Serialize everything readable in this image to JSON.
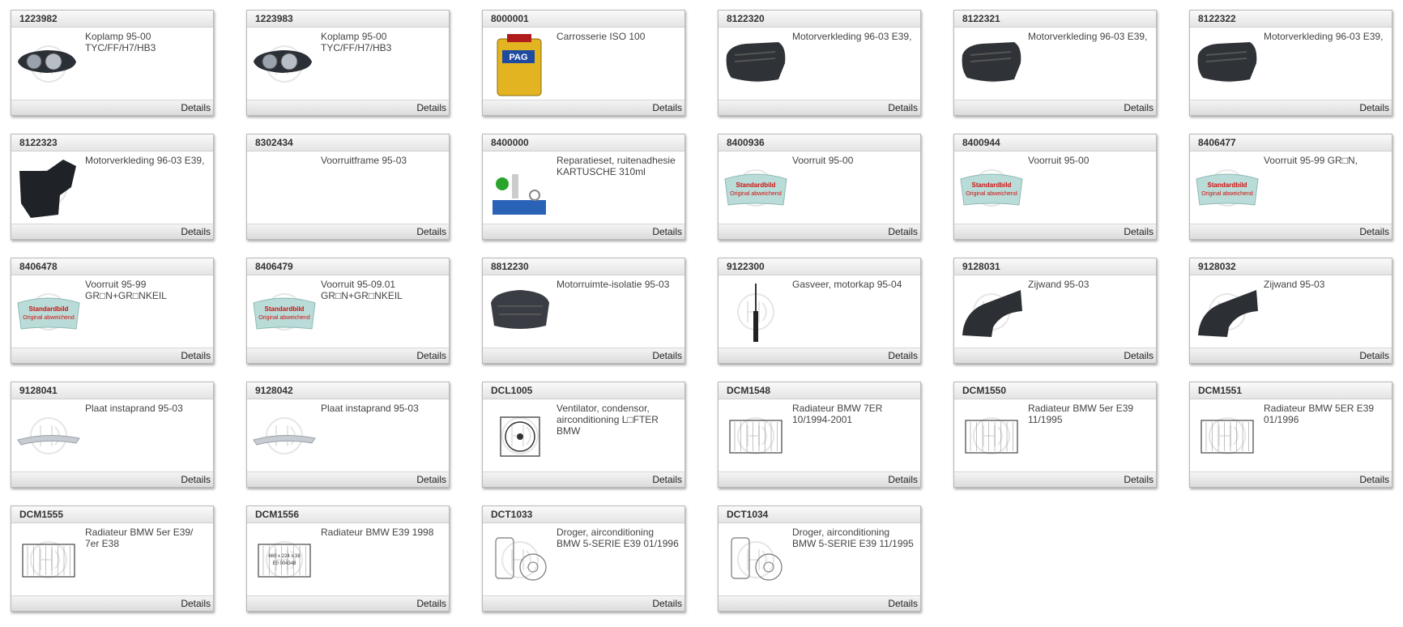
{
  "details_label": "Details",
  "products": [
    {
      "code": "1223982",
      "desc": "Koplamp 95-00 TYC/FF/H7/HB3",
      "image": "headlamp"
    },
    {
      "code": "1223983",
      "desc": "Koplamp 95-00 TYC/FF/H7/HB3",
      "image": "headlamp"
    },
    {
      "code": "8000001",
      "desc": "Carrosserie ISO 100",
      "image": "tin-can",
      "can_label": "PAG"
    },
    {
      "code": "8122320",
      "desc": "Motorverkleding 96-03 E39,",
      "image": "engine-cover"
    },
    {
      "code": "8122321",
      "desc": "Motorverkleding 96-03 E39,",
      "image": "engine-cover"
    },
    {
      "code": "8122322",
      "desc": "Motorverkleding 96-03 E39,",
      "image": "engine-cover"
    },
    {
      "code": "8122323",
      "desc": "Motorverkleding 96-03 E39,",
      "image": "splash-shield"
    },
    {
      "code": "8302434",
      "desc": "Voorruitframe 95-03",
      "image": "none"
    },
    {
      "code": "8400000",
      "desc": "Reparatieset, ruitenadhesie KARTUSCHE 310ml",
      "image": "repair-kit"
    },
    {
      "code": "8400936",
      "desc": "Voorruit 95-00",
      "image": "windshield",
      "badge_title": "Standardbild",
      "badge_sub": "Original abweichend"
    },
    {
      "code": "8400944",
      "desc": "Voorruit 95-00",
      "image": "windshield",
      "badge_title": "Standardbild",
      "badge_sub": "Original abweichend"
    },
    {
      "code": "8406477",
      "desc": "Voorruit 95-99 GR□N,",
      "image": "windshield",
      "badge_title": "Standardbild",
      "badge_sub": "Original abweichend"
    },
    {
      "code": "8406478",
      "desc": "Voorruit 95-99 GR□N+GR□NKEIL",
      "image": "windshield",
      "badge_title": "Standardbild",
      "badge_sub": "Original abweichend"
    },
    {
      "code": "8406479",
      "desc": "Voorruit 95-09.01 GR□N+GR□NKEIL",
      "image": "windshield",
      "badge_title": "Standardbild",
      "badge_sub": "Original abweichend"
    },
    {
      "code": "8812230",
      "desc": "Motorruimte-isolatie 95-03",
      "image": "insulation"
    },
    {
      "code": "9122300",
      "desc": "Gasveer, motorkap 95-04",
      "image": "gas-spring"
    },
    {
      "code": "9128031",
      "desc": "Zijwand 95-03",
      "image": "side-panel"
    },
    {
      "code": "9128032",
      "desc": "Zijwand 95-03",
      "image": "side-panel"
    },
    {
      "code": "9128041",
      "desc": "Plaat instaprand 95-03",
      "image": "sill-plate"
    },
    {
      "code": "9128042",
      "desc": "Plaat instaprand 95-03",
      "image": "sill-plate"
    },
    {
      "code": "DCL1005",
      "desc": "Ventilator, condensor, airconditioning L□FTER BMW",
      "image": "fan"
    },
    {
      "code": "DCM1548",
      "desc": "Radiateur BMW 7ER 10/1994-2001",
      "image": "radiator"
    },
    {
      "code": "DCM1550",
      "desc": "Radiateur BMW 5er E39 11/1995",
      "image": "radiator"
    },
    {
      "code": "DCM1551",
      "desc": "Radiateur BMW 5ER E39 01/1996",
      "image": "radiator"
    },
    {
      "code": "DCM1555",
      "desc": "Radiateur BMW 5er E39/ 7er E38",
      "image": "radiator"
    },
    {
      "code": "DCM1556",
      "desc": "Radiateur BMW E39 1998",
      "image": "radiator-drawing",
      "drawing_line1": "660 x 224 x 38",
      "drawing_line2": "E0 004348"
    },
    {
      "code": "DCT1033",
      "desc": "Droger, airconditioning BMW 5-SERIE E39 01/1996",
      "image": "dryer"
    },
    {
      "code": "DCT1034",
      "desc": "Droger, airconditioning BMW 5-SERIE E39 11/1995",
      "image": "dryer"
    }
  ]
}
